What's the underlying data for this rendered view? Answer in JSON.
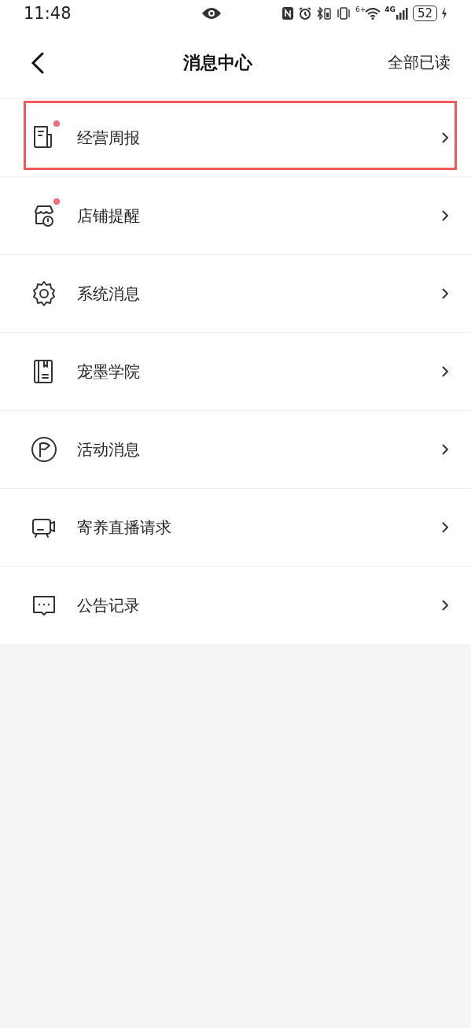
{
  "status_bar": {
    "time": "11:48",
    "battery": "52",
    "network": "4G",
    "wifi_badge": "6+"
  },
  "header": {
    "title": "消息中心",
    "action": "全部已读"
  },
  "items": [
    {
      "kind": "report",
      "label": "经营周报",
      "unread": true,
      "highlighted": true
    },
    {
      "kind": "store",
      "label": "店铺提醒",
      "unread": true,
      "highlighted": false
    },
    {
      "kind": "gear",
      "label": "系统消息",
      "unread": false,
      "highlighted": false
    },
    {
      "kind": "book",
      "label": "宠墨学院",
      "unread": false,
      "highlighted": false
    },
    {
      "kind": "flag",
      "label": "活动消息",
      "unread": false,
      "highlighted": false
    },
    {
      "kind": "camera",
      "label": "寄养直播请求",
      "unread": false,
      "highlighted": false
    },
    {
      "kind": "chat",
      "label": "公告记录",
      "unread": false,
      "highlighted": false
    }
  ]
}
